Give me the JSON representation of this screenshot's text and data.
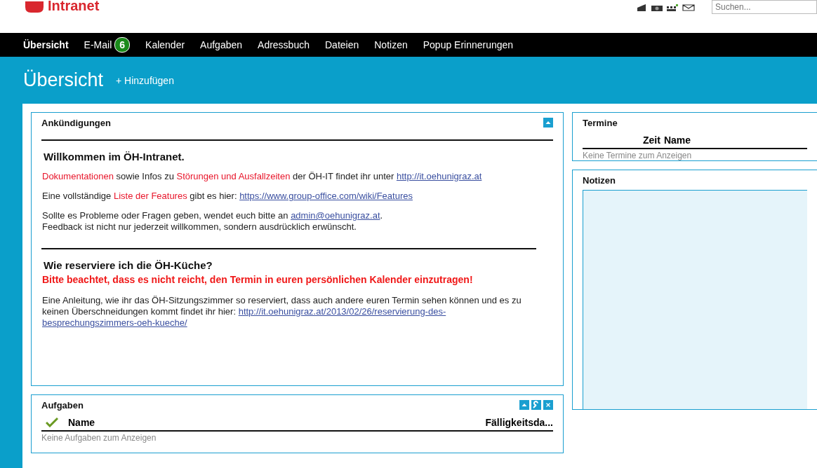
{
  "header": {
    "logo_text": "Intranet",
    "search": {
      "placeholder": "Suchen..."
    }
  },
  "nav": [
    {
      "label": "Übersicht",
      "selected": true
    },
    {
      "label": "E-Mail",
      "selected": false,
      "badge": "6"
    },
    {
      "label": "Kalender",
      "selected": false
    },
    {
      "label": "Aufgaben",
      "selected": false
    },
    {
      "label": "Adressbuch",
      "selected": false
    },
    {
      "label": "Dateien",
      "selected": false
    },
    {
      "label": "Notizen",
      "selected": false
    },
    {
      "label": "Popup Erinnerungen",
      "selected": false
    }
  ],
  "page": {
    "title": "Übersicht",
    "add_label": "+ Hinzufügen"
  },
  "announcements": {
    "title": "Ankündigungen",
    "heading1": "Willkommen im ÖH-Intranet.",
    "paragraphs1": [
      [
        {
          "kind": "highlight",
          "text": "Dokumentationen"
        },
        {
          "kind": "text",
          "text": " sowie Infos zu "
        },
        {
          "kind": "highlight",
          "text": "Störungen und Ausfallzeiten"
        },
        {
          "kind": "text",
          "text": " der ÖH-IT findet ihr unter "
        },
        {
          "kind": "link",
          "text": "http://it.oehunigraz.at"
        }
      ],
      [
        {
          "kind": "text",
          "text": "Eine vollständige "
        },
        {
          "kind": "highlight",
          "text": "Liste der Features"
        },
        {
          "kind": "text",
          "text": " gibt es hier: "
        },
        {
          "kind": "link",
          "text": "https://www.group-office.com/wiki/Features"
        }
      ],
      [
        {
          "kind": "text",
          "text": "Sollte es Probleme oder Fragen geben, wendet euch bitte an "
        },
        {
          "kind": "link",
          "text": "admin@oehunigraz.at"
        },
        {
          "kind": "text",
          "text": "."
        },
        {
          "kind": "break"
        },
        {
          "kind": "text",
          "text": "Feedback ist nicht nur jederzeit willkommen, sondern ausdrücklich erwünscht."
        }
      ]
    ],
    "heading2": "Wie reserviere ich die ÖH-Küche?",
    "warning": "Bitte beachtet, dass es nicht reicht, den Termin in euren persönlichen Kalender einzutragen!",
    "paragraphs2": [
      [
        {
          "kind": "text",
          "text": "Eine Anleitung, wie ihr das ÖH-Sitzungszimmer so reserviert, dass auch andere euren Termin sehen können und es zu keinen Überschneidungen kommt findet ihr hier: "
        },
        {
          "kind": "link",
          "text": "http://it.oehunigraz.at/2013/02/26/reservierung-des-"
        },
        {
          "kind": "break"
        },
        {
          "kind": "link",
          "text": "besprechungszimmers-oeh-kueche/"
        }
      ]
    ]
  },
  "tasks": {
    "title": "Aufgaben",
    "columns": [
      "Name",
      "Fälligkeitsda..."
    ],
    "empty": "Keine Aufgaben zum Anzeigen"
  },
  "appointments": {
    "title": "Termine",
    "columns": [
      "Zeit",
      "Name"
    ],
    "empty": "Keine Termine zum Anzeigen"
  },
  "notes": {
    "title": "Notizen"
  }
}
